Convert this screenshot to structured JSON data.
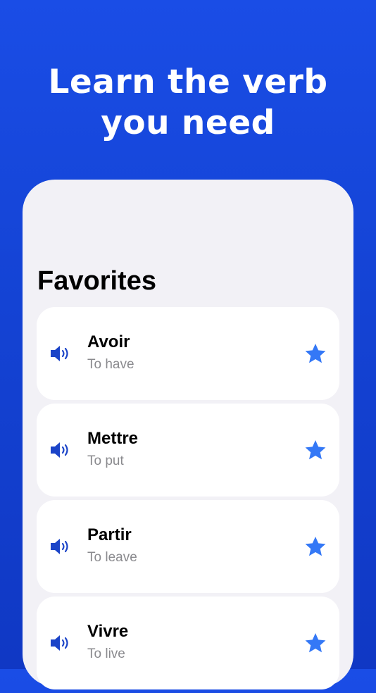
{
  "headline": {
    "line1": "Learn the verb",
    "line2": "you need"
  },
  "favorites": {
    "title": "Favorites",
    "items": [
      {
        "verb": "Avoir",
        "translation": "To have",
        "favorited": true
      },
      {
        "verb": "Mettre",
        "translation": "To put",
        "favorited": true
      },
      {
        "verb": "Partir",
        "translation": "To leave",
        "favorited": true
      },
      {
        "verb": "Vivre",
        "translation": "To live",
        "favorited": true
      }
    ]
  },
  "icons": {
    "speaker": "speaker-wave-icon",
    "star": "star-filled-icon"
  },
  "colors": {
    "background": "#1443d4",
    "speaker": "#1b44c8",
    "star": "#3478f6",
    "card": "#ffffff",
    "panel": "#f2f1f6",
    "secondary_text": "#8a8a8e"
  }
}
